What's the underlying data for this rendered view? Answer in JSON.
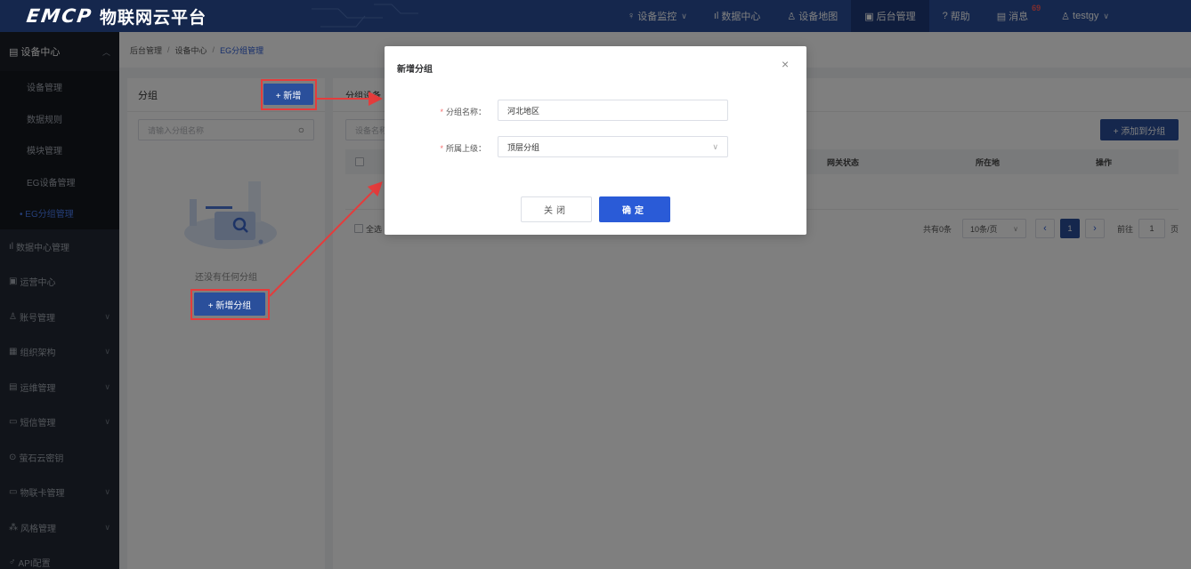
{
  "brand": {
    "logo_mark": "EMCP",
    "name": "物联网云平台"
  },
  "topnav": [
    {
      "icon": "♀",
      "label": "设备监控",
      "caret": "∨"
    },
    {
      "icon": "ıl",
      "label": "数据中心"
    },
    {
      "icon": "♙",
      "label": "设备地图"
    },
    {
      "icon": "▣",
      "label": "后台管理"
    },
    {
      "icon": "?",
      "label": "帮助"
    },
    {
      "icon": "▤",
      "label": "消息",
      "badge": "69"
    },
    {
      "icon": "♙",
      "label": "testgy",
      "caret": "∨"
    }
  ],
  "sidebar": {
    "header": {
      "icon": "▤",
      "label": "设备中心"
    },
    "sub_items": [
      "设备管理",
      "数据规则",
      "模块管理",
      "EG设备管理",
      "• EG分组管理"
    ],
    "items": [
      {
        "icon": "ıl",
        "label": "数据中心管理",
        "caret": ""
      },
      {
        "icon": "▣",
        "label": "运营中心",
        "caret": ""
      },
      {
        "icon": "♙",
        "label": "账号管理",
        "caret": "∨"
      },
      {
        "icon": "▦",
        "label": "组织架构",
        "caret": "∨"
      },
      {
        "icon": "▤",
        "label": "运维管理",
        "caret": "∨"
      },
      {
        "icon": "▭",
        "label": "短信管理",
        "caret": "∨"
      },
      {
        "icon": "⊙",
        "label": "萤石云密钥",
        "caret": ""
      },
      {
        "icon": "▭",
        "label": "物联卡管理",
        "caret": "∨"
      },
      {
        "icon": "⁂",
        "label": "风格管理",
        "caret": "∨"
      },
      {
        "icon": "♂",
        "label": "API配置",
        "caret": ""
      }
    ]
  },
  "breadcrumb": {
    "level1": "后台管理",
    "level2": "设备中心",
    "current": "EG分组管理",
    "sep": "/"
  },
  "left_panel": {
    "title": "分组",
    "add_label": "+ 新增",
    "search_placeholder": "请输入分组名称",
    "empty_text": "还没有任何分组",
    "add_group_label": "+ 新增分组"
  },
  "right_panel": {
    "title": "分组设备",
    "search_placeholder": "设备名称",
    "add_to_group_label": "+ 添加到分组",
    "columns": {
      "gateway_status": "网关状态",
      "location": "所在地",
      "actions": "操作"
    },
    "select_all": "全选",
    "pager": {
      "total": "共有0条",
      "page_size": "10条/页",
      "current_page": "1",
      "goto_label": "前往",
      "goto_value": "1",
      "page_unit": "页"
    }
  },
  "modal": {
    "title": "新增分组",
    "close_icon": "×",
    "fields": {
      "name": {
        "label": "分组名称：",
        "value": "河北地区"
      },
      "parent": {
        "label": "所属上级：",
        "value": "顶层分组"
      }
    },
    "cancel_label": "关闭",
    "ok_label": "确定"
  },
  "colors": {
    "primary": "#2a4f9b",
    "accent": "#2a5bd7",
    "annotation": "#e43c3c",
    "sidebar_bg": "#222934"
  }
}
